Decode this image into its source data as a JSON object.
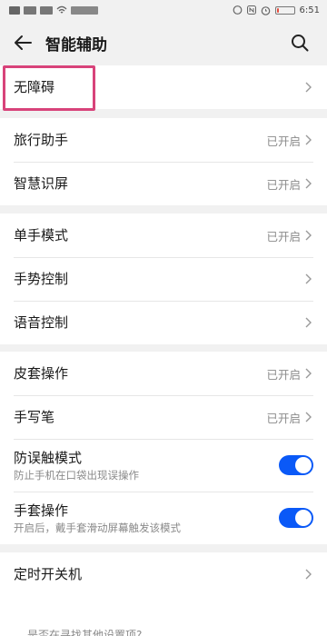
{
  "status_bar": {
    "time": "6:51",
    "left_icons": [
      "sim-card-icon",
      "signal-1-icon",
      "signal-2-icon",
      "wifi-icon",
      "notification-icons"
    ],
    "right_icons": [
      "nfc-icon",
      "nfc-n-icon",
      "alarm-icon"
    ],
    "battery_level": 0.15
  },
  "header": {
    "title": "智能辅助",
    "back_icon": "back-arrow-icon",
    "search_icon": "search-icon"
  },
  "sections": [
    {
      "items": [
        {
          "label": "无障碍"
        }
      ]
    },
    {
      "items": [
        {
          "label": "旅行助手",
          "status": "已开启"
        },
        {
          "label": "智慧识屏",
          "status": "已开启"
        }
      ]
    },
    {
      "items": [
        {
          "label": "单手模式",
          "status": "已开启"
        },
        {
          "label": "手势控制"
        },
        {
          "label": "语音控制"
        }
      ]
    },
    {
      "items": [
        {
          "label": "皮套操作",
          "status": "已开启"
        },
        {
          "label": "手写笔",
          "status": "已开启"
        },
        {
          "label": "防误触模式",
          "subtitle": "防止手机在口袋出现误操作",
          "toggle": true
        },
        {
          "label": "手套操作",
          "subtitle": "开启后，戴手套滑动屏幕触发该模式",
          "toggle": true
        }
      ]
    },
    {
      "items": [
        {
          "label": "定时开关机"
        }
      ]
    }
  ],
  "footer": {
    "text": "是否在寻找其他设置项?"
  },
  "colors": {
    "accent": "#0a59f7",
    "highlight_box": "#d8437a",
    "background": "#f1f1f1"
  }
}
